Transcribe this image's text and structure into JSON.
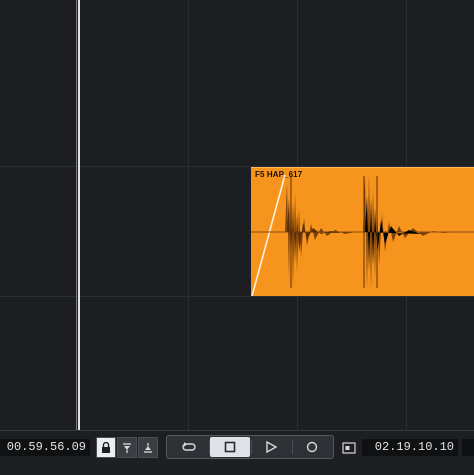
{
  "clip": {
    "name": "F5 HAP_617",
    "color": "#f7941d"
  },
  "transport": {
    "left_time": "00.59.56.09",
    "right_time": "02.19.10.10",
    "buttons": [
      {
        "name": "lock-icon"
      },
      {
        "name": "punch-in-icon"
      },
      {
        "name": "punch-out-icon"
      },
      {
        "name": "cycle-icon"
      },
      {
        "name": "stop-icon"
      },
      {
        "name": "play-icon"
      },
      {
        "name": "record-icon"
      },
      {
        "name": "timecode-icon"
      }
    ]
  },
  "colors": {
    "background": "#1c1e21",
    "clip": "#f7941d",
    "waveform": "#8a4a10",
    "playhead": "#e6e6e6"
  }
}
